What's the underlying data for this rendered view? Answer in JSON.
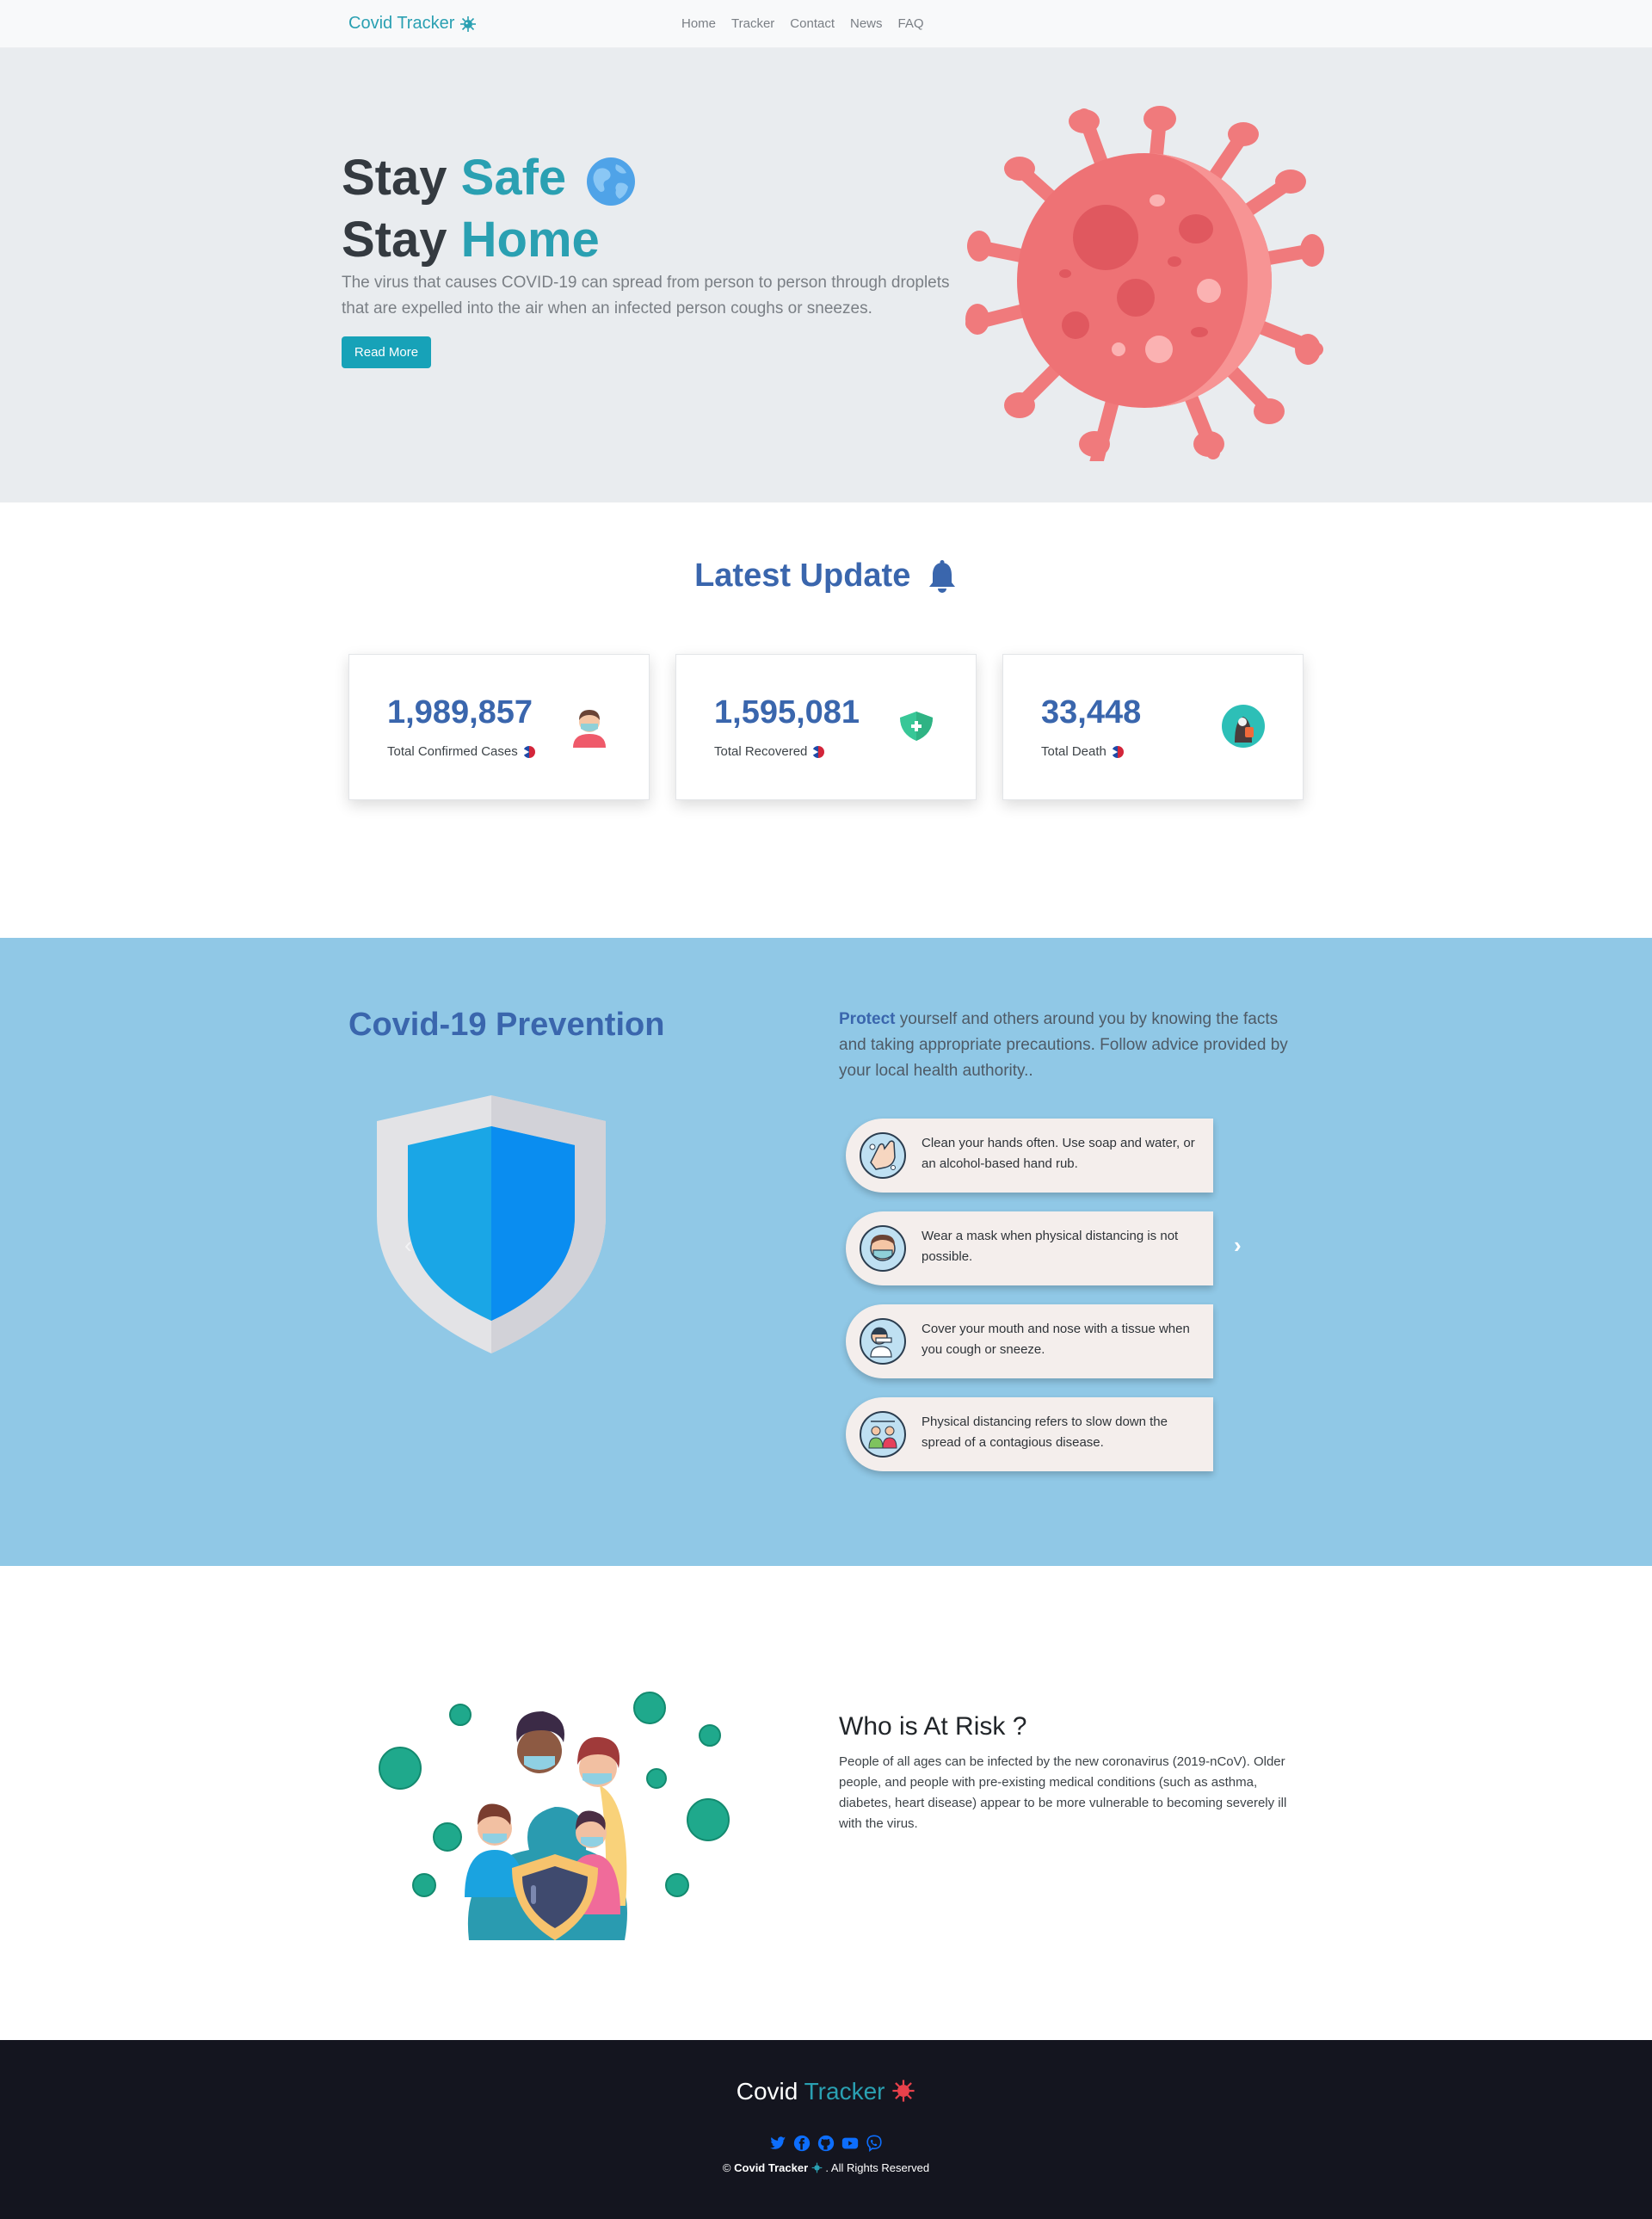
{
  "nav": {
    "brand": "Covid Tracker",
    "brand_icon": "virus-icon",
    "links": [
      "Home",
      "Tracker",
      "Contact",
      "News",
      "FAQ"
    ]
  },
  "hero": {
    "line1_prefix": "Stay",
    "line1_accent": "Safe",
    "line1_icon": "globe-icon",
    "line2_prefix": "Stay",
    "line2_accent": "Home",
    "description": "The virus that causes COVID-19 can spread from person to person through droplets that are expelled into the air when an infected person coughs or sneezes.",
    "button": "Read More",
    "illustration": "coronavirus-illustration"
  },
  "update": {
    "title": "Latest Update",
    "title_icon": "bell-icon",
    "cards": [
      {
        "value": "1,989,857",
        "label": "Total Confirmed Cases",
        "icon": "masked-person-icon"
      },
      {
        "value": "1,595,081",
        "label": "Total Recovered",
        "icon": "shield-plus-icon"
      },
      {
        "value": "33,448",
        "label": "Total Death",
        "icon": "grim-reaper-icon"
      }
    ]
  },
  "prevention": {
    "title": "Covid-19 Prevention",
    "intro_strong": "Protect",
    "intro_rest": " yourself and others around you by knowing the facts and taking appropriate precautions. Follow advice provided by your local health authority..",
    "tips": [
      {
        "text": "Clean your hands often. Use soap and water, or an alcohol-based hand rub.",
        "icon": "hand-wash-icon"
      },
      {
        "text": "Wear a mask when physical distancing is not possible.",
        "icon": "face-mask-icon"
      },
      {
        "text": "Cover your mouth and nose with a tissue when you cough or sneeze.",
        "icon": "sneeze-icon"
      },
      {
        "text": "Physical distancing refers to slow down the spread of a contagious disease.",
        "icon": "distancing-icon"
      }
    ]
  },
  "risk": {
    "title": "Who is At Risk ?",
    "text": "People of all ages can be infected by the new coronavirus (2019-nCoV). Older people, and people with pre-existing medical conditions (such as asthma, diabetes, heart disease) appear to be more vulnerable to becoming severely ill with the virus."
  },
  "footer": {
    "brand_prefix": "Covid",
    "brand_accent": "Tracker",
    "socials": [
      "twitter-icon",
      "facebook-icon",
      "github-icon",
      "youtube-icon",
      "viber-icon"
    ],
    "copy_symbol": "©",
    "copy_brand": "Covid Tracker",
    "copy_rest": ". All Rights Reserved"
  },
  "colors": {
    "accent_teal": "#17a2b8",
    "heading_blue": "#3a66ad",
    "prevention_bg": "#90c8e6",
    "footer_bg": "#14151f",
    "virus_red": "#f08080"
  }
}
